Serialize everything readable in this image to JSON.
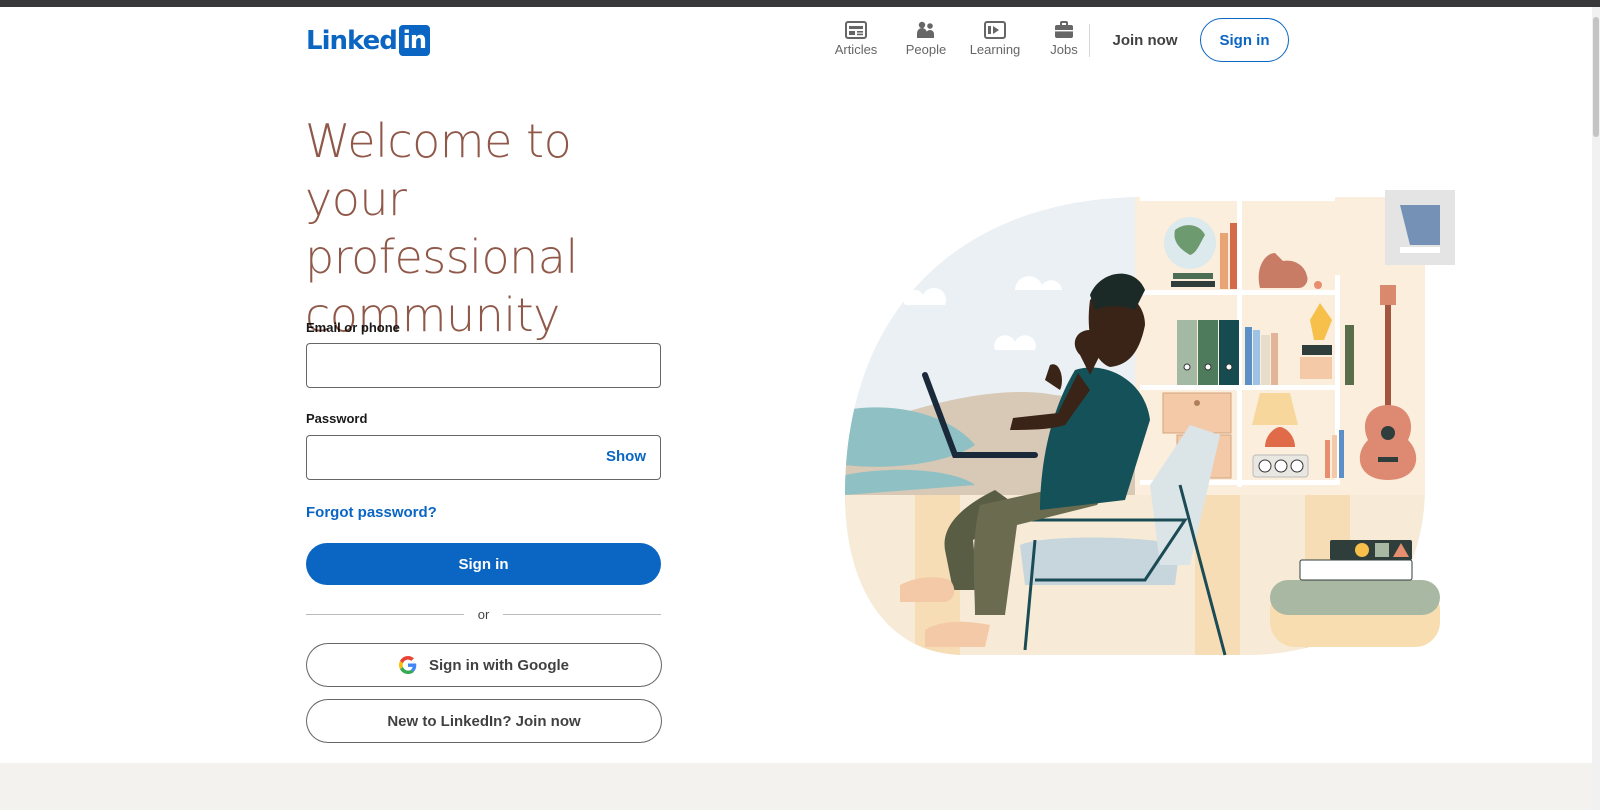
{
  "brand": {
    "logo_text": "Linked",
    "logo_box": "in"
  },
  "nav": {
    "items": [
      {
        "label": "Articles",
        "icon": "articles-icon"
      },
      {
        "label": "People",
        "icon": "people-icon"
      },
      {
        "label": "Learning",
        "icon": "learning-icon"
      },
      {
        "label": "Jobs",
        "icon": "jobs-icon"
      }
    ],
    "join_now": "Join now",
    "sign_in": "Sign in"
  },
  "hero": {
    "headline": "Welcome to your professional community"
  },
  "form": {
    "email_label": "Email or phone",
    "email_value": "",
    "password_label": "Password",
    "password_value": "",
    "show_label": "Show",
    "forgot_label": "Forgot password?",
    "signin_label": "Sign in",
    "or_label": "or",
    "google_label": "Sign in with Google",
    "join_label": "New to LinkedIn? Join now"
  },
  "colors": {
    "brand_blue": "#0a66c2",
    "headline": "#8f5849",
    "footer_band": "#f3f2ef"
  }
}
